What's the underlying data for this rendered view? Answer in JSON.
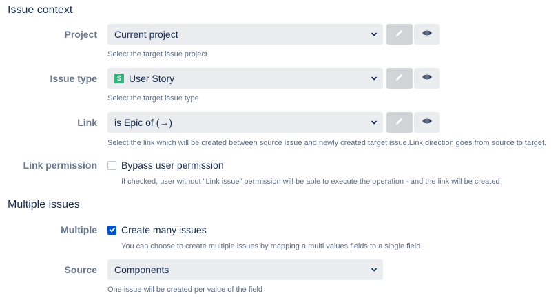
{
  "issue_context": {
    "title": "Issue context",
    "project": {
      "label": "Project",
      "value": "Current project",
      "help": "Select the target issue project"
    },
    "issue_type": {
      "label": "Issue type",
      "value": "User Story",
      "badge_glyph": "$",
      "badge_color": "#36b37e",
      "help": "Select the target issue type"
    },
    "link": {
      "label": "Link",
      "value": "is Epic of (→)",
      "help": "Select the link which will be created between source issue and newly created target issue.Link direction goes from source to target."
    },
    "link_permission": {
      "label": "Link permission",
      "checkbox_label": "Bypass user permission",
      "checked": false,
      "help": "If checked, user without \"Link issue\" permission will be able to execute the operation - and the link will be created"
    }
  },
  "multiple_issues": {
    "title": "Multiple issues",
    "multiple": {
      "label": "Multiple",
      "checkbox_label": "Create many issues",
      "checked": true,
      "help": "You can choose to create multiple issues by mapping a multi values fields to a single field."
    },
    "source": {
      "label": "Source",
      "value": "Components",
      "help": "One issue will be created per value of the field"
    }
  },
  "icons": {
    "edit": "pencil-icon",
    "preview": "eye-icon",
    "dropdown": "chevron-down-icon",
    "checked": "checkmark-icon"
  },
  "colors": {
    "accent": "#0052cc",
    "text": "#172b4d",
    "label": "#6b778c",
    "help": "#5e6c84",
    "field_bg": "#ebecf0"
  }
}
